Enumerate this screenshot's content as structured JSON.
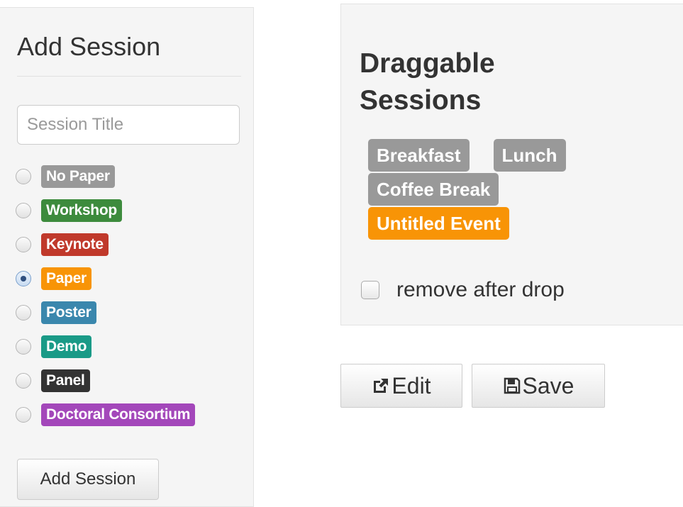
{
  "add_session": {
    "heading": "Add Session",
    "title_placeholder": "Session Title",
    "types": [
      {
        "label": "No Paper",
        "color": "#999999",
        "checked": false
      },
      {
        "label": "Workshop",
        "color": "#3d8b3d",
        "checked": false
      },
      {
        "label": "Keynote",
        "color": "#c0392b",
        "checked": false
      },
      {
        "label": "Paper",
        "color": "#f89406",
        "checked": true
      },
      {
        "label": "Poster",
        "color": "#3a87ad",
        "checked": false
      },
      {
        "label": "Demo",
        "color": "#1a9a87",
        "checked": false
      },
      {
        "label": "Panel",
        "color": "#333333",
        "checked": false
      },
      {
        "label": "Doctoral Consortium",
        "color": "#a347ba",
        "checked": false
      }
    ],
    "add_button": "Add Session"
  },
  "draggable": {
    "heading": "Draggable Sessions",
    "events": [
      {
        "label": "Breakfast",
        "color": "#999999"
      },
      {
        "label": "Lunch",
        "color": "#999999"
      },
      {
        "label": "Coffee Break",
        "color": "#999999"
      },
      {
        "label": "Untitled Event",
        "color": "#f89406"
      }
    ],
    "remove_after_drop": {
      "label": "remove after drop",
      "checked": false
    }
  },
  "actions": {
    "edit": {
      "label": "Edit",
      "icon": "external-edit-icon"
    },
    "save": {
      "label": "Save",
      "icon": "floppy-disk-icon"
    }
  }
}
